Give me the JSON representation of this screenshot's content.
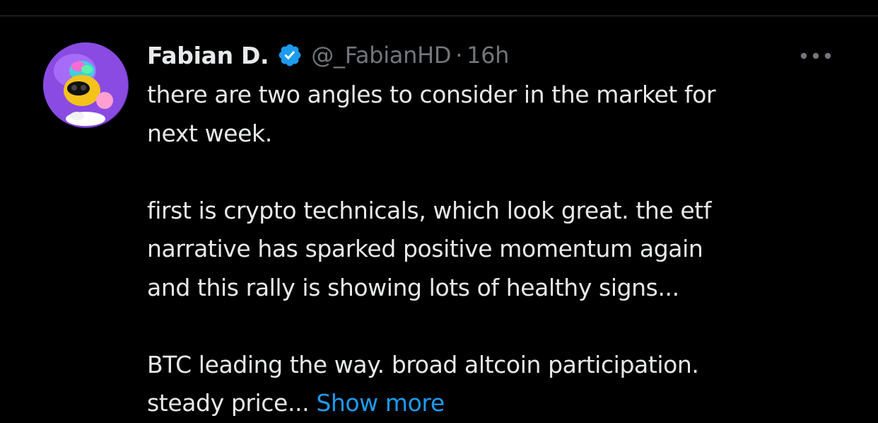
{
  "tweet": {
    "author": {
      "display_name": "Fabian D.",
      "handle": "@_FabianHD",
      "verified": true,
      "avatar_icon": "avatar-image"
    },
    "separator": "·",
    "time": "16h",
    "more_icon": "more-options-icon",
    "paragraphs": [
      [
        "there are two angles to consider in the market for",
        "next week."
      ],
      [
        "first is crypto technicals, which look great. the etf",
        "narrative has sparked positive momentum again",
        "and this rally is showing lots of healthy signs..."
      ]
    ],
    "last_paragraph": {
      "line1": "BTC leading the way. broad altcoin participation.",
      "line2": "steady price...",
      "show_more": "Show more"
    }
  },
  "colors": {
    "background": "#000000",
    "primary_text": "#e7e9ea",
    "secondary_text": "#71767b",
    "accent": "#1d9bf0",
    "divider": "#2f3336"
  }
}
